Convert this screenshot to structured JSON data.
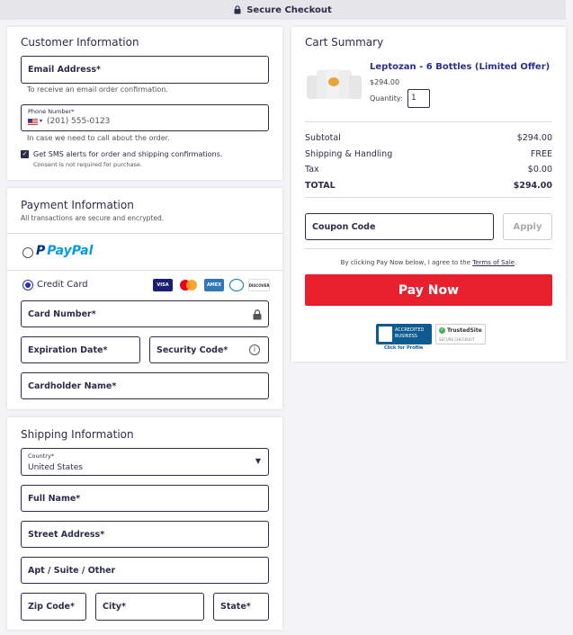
{
  "header": {
    "title": "Secure Checkout"
  },
  "customer": {
    "heading": "Customer Information",
    "email_label": "Email Address*",
    "email_hint": "To receive an email order confirmation.",
    "phone_label": "Phone Number*",
    "phone_placeholder": "(201) 555-0123",
    "phone_hint": "In case we need to call about the order.",
    "sms_label": "Get SMS alerts for order and shipping confirmations.",
    "sms_hint": "Consent is not required for purchase."
  },
  "payment": {
    "heading": "Payment Information",
    "subheading": "All transactions are secure and encrypted.",
    "paypal_label": "PayPal",
    "card_label": "Credit Card",
    "card_number_label": "Card Number*",
    "expiration_label": "Expiration Date*",
    "security_label": "Security Code*",
    "holder_label": "Cardholder Name*",
    "brands": [
      "VISA",
      "mastercard",
      "AMEX",
      "diners",
      "DISCOVER"
    ]
  },
  "shipping": {
    "heading": "Shipping Information",
    "country_label": "Country*",
    "country_value": "United States",
    "full_name_label": "Full Name*",
    "street_label": "Street Address*",
    "apt_label": "Apt / Suite / Other",
    "zip_label": "Zip Code*",
    "city_label": "City*",
    "state_label": "State*"
  },
  "cart": {
    "heading": "Cart Summary",
    "product_name": "Leptozan - 6 Bottles (Limited Offer)",
    "product_price": "$294.00",
    "quantity_label": "Quantity:",
    "quantity_value": "1",
    "subtotal_label": "Subtotal",
    "subtotal_value": "$294.00",
    "shipping_label": "Shipping & Handling",
    "shipping_value": "FREE",
    "tax_label": "Tax",
    "tax_value": "$0.00",
    "total_label": "TOTAL",
    "total_value": "$294.00",
    "coupon_placeholder": "Coupon Code",
    "apply_label": "Apply",
    "terms_prefix": "By clicking Pay Now below, I agree to the",
    "terms_link": "Terms of Sale",
    "terms_suffix": ".",
    "pay_label": "Pay Now"
  },
  "badges": {
    "bbb_line1": "ACCREDITED",
    "bbb_line2": "BUSINESS",
    "bbb_caption": "Click for Profile",
    "trusted_title": "TrustedSite",
    "trusted_sub": "SECURE CHECKOUT"
  },
  "colors": {
    "accent": "#2a2fb7",
    "pay_button": "#e8202e",
    "text": "#2b2d4a"
  }
}
